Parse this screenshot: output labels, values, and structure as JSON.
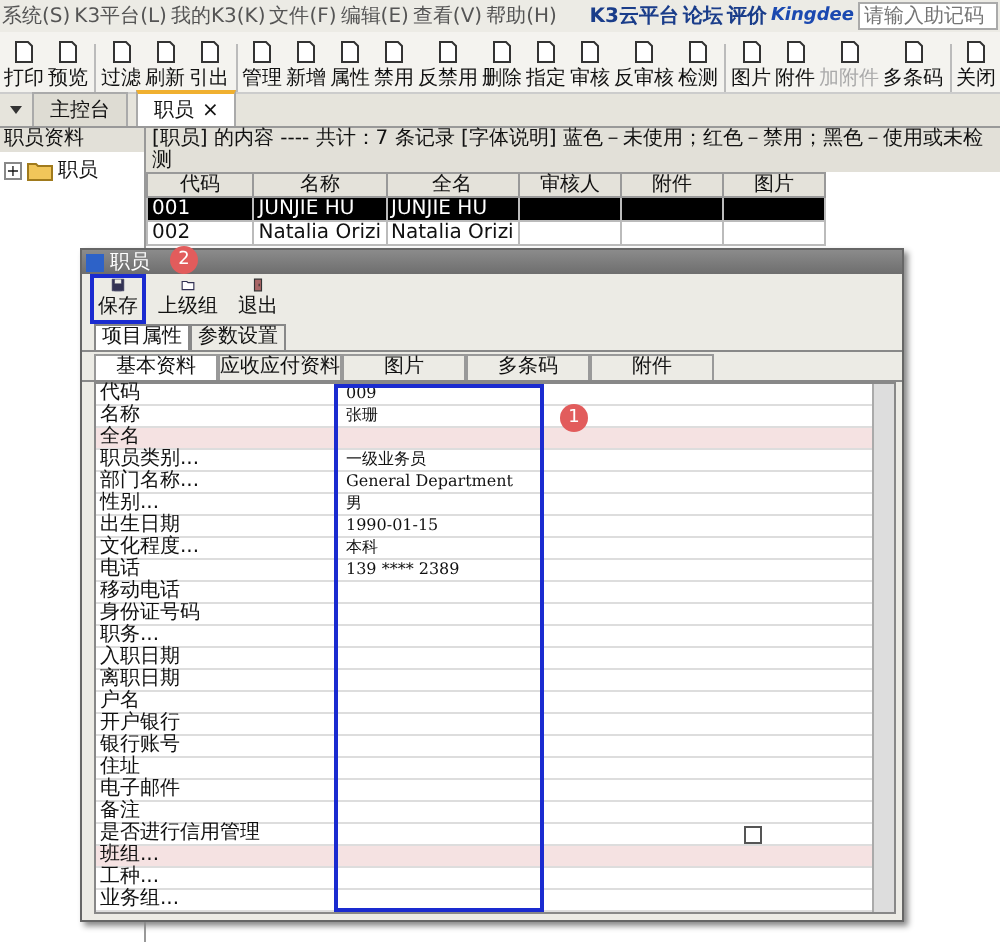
{
  "menu": [
    "系统(S)",
    "K3平台(L)",
    "我的K3(K)",
    "文件(F)",
    "编辑(E)",
    "查看(V)",
    "帮助(H)"
  ],
  "top_links": [
    "K3云平台",
    "论坛",
    "评价"
  ],
  "brand": "Kingdee",
  "search": {
    "placeholder": "请输入助记码"
  },
  "toolbar": [
    [
      {
        "label": "打印",
        "disabled": false
      },
      {
        "label": "预览",
        "disabled": false
      }
    ],
    [
      {
        "label": "过滤",
        "disabled": false
      },
      {
        "label": "刷新",
        "disabled": false
      },
      {
        "label": "引出",
        "disabled": false
      }
    ],
    [
      {
        "label": "管理",
        "disabled": false
      },
      {
        "label": "新增",
        "disabled": false
      },
      {
        "label": "属性",
        "disabled": false
      },
      {
        "label": "禁用",
        "disabled": false
      },
      {
        "label": "反禁用",
        "disabled": false
      },
      {
        "label": "删除",
        "disabled": false
      },
      {
        "label": "指定",
        "disabled": false
      },
      {
        "label": "审核",
        "disabled": false
      },
      {
        "label": "反审核",
        "disabled": false
      },
      {
        "label": "检测",
        "disabled": false
      }
    ],
    [
      {
        "label": "图片",
        "disabled": false
      },
      {
        "label": "附件",
        "disabled": false
      },
      {
        "label": "加附件",
        "disabled": true
      },
      {
        "label": "多条码",
        "disabled": false
      }
    ],
    [
      {
        "label": "关闭",
        "disabled": false
      }
    ]
  ],
  "tabs": [
    {
      "label": "主控台",
      "selected": false
    },
    {
      "label": "职员",
      "selected": true,
      "close": "×"
    }
  ],
  "sidebar": {
    "title": "职员资料",
    "tree": [
      {
        "label": "职员",
        "toggle": "+"
      }
    ]
  },
  "info": "[职员] 的内容 ---- 共计：7 条记录  [字体说明] 蓝色－未使用；红色－禁用；黑色－使用或未检测",
  "table": {
    "columns": [
      "代码",
      "名称",
      "全名",
      "审核人",
      "附件",
      "图片"
    ],
    "rows": [
      {
        "cells": [
          "001",
          "JUNJIE HU",
          "JUNJIE HU",
          "",
          "",
          ""
        ],
        "selected": true
      },
      {
        "cells": [
          "002",
          "Natalia Orizi",
          "Natalia Orizi",
          "",
          "",
          ""
        ],
        "selected": false
      }
    ]
  },
  "dialog": {
    "title": "职员",
    "toolbar": [
      {
        "label": "保存",
        "highlighted": true
      },
      {
        "label": "上级组",
        "highlighted": false
      },
      {
        "label": "退出",
        "highlighted": false
      }
    ],
    "tabs": [
      {
        "label": "项目属性",
        "selected": true
      },
      {
        "label": "参数设置",
        "selected": false
      }
    ],
    "subtabs": [
      {
        "label": "基本资料",
        "selected": true
      },
      {
        "label": "应收应付资料",
        "selected": false
      },
      {
        "label": "图片",
        "selected": false
      },
      {
        "label": "多条码",
        "selected": false
      },
      {
        "label": "附件",
        "selected": false
      }
    ],
    "value_column_highlighted": true,
    "fields": [
      {
        "kind": "text",
        "label": "代码",
        "value": "009",
        "required": false
      },
      {
        "kind": "text",
        "label": "名称",
        "value": "张珊",
        "required": false
      },
      {
        "kind": "text",
        "label": "全名",
        "required": true
      },
      {
        "kind": "text",
        "label": "职员类别...",
        "value": "一级业务员",
        "required": false
      },
      {
        "kind": "text",
        "label": "部门名称...",
        "value": "General Department",
        "required": false
      },
      {
        "kind": "text",
        "label": "性别...",
        "value": "男",
        "required": false
      },
      {
        "kind": "text",
        "label": "出生日期",
        "value": "1990-01-15",
        "required": false
      },
      {
        "kind": "text",
        "label": "文化程度...",
        "value": "本科",
        "required": false
      },
      {
        "kind": "text",
        "label": "电话",
        "value": "139 **** 2389",
        "required": false
      },
      {
        "kind": "text",
        "label": "移动电话",
        "required": false
      },
      {
        "kind": "text",
        "label": "身份证号码",
        "required": false
      },
      {
        "kind": "text",
        "label": "职务...",
        "required": false
      },
      {
        "kind": "text",
        "label": "入职日期",
        "required": false
      },
      {
        "kind": "text",
        "label": "离职日期",
        "required": false
      },
      {
        "kind": "text",
        "label": "户名",
        "required": false
      },
      {
        "kind": "text",
        "label": "开户银行",
        "required": false
      },
      {
        "kind": "text",
        "label": "银行账号",
        "required": false
      },
      {
        "kind": "text",
        "label": "住址",
        "required": false
      },
      {
        "kind": "text",
        "label": "电子邮件",
        "required": false
      },
      {
        "kind": "text",
        "label": "备注",
        "required": false
      },
      {
        "kind": "checkbox",
        "label": "是否进行信用管理",
        "checked": false,
        "required": false
      },
      {
        "kind": "text",
        "label": "班组...",
        "required": true
      },
      {
        "kind": "text",
        "label": "工种...",
        "required": false
      },
      {
        "kind": "text",
        "label": "业务组...",
        "required": false
      }
    ]
  },
  "annotations": [
    {
      "label": "1"
    },
    {
      "label": "2"
    }
  ]
}
